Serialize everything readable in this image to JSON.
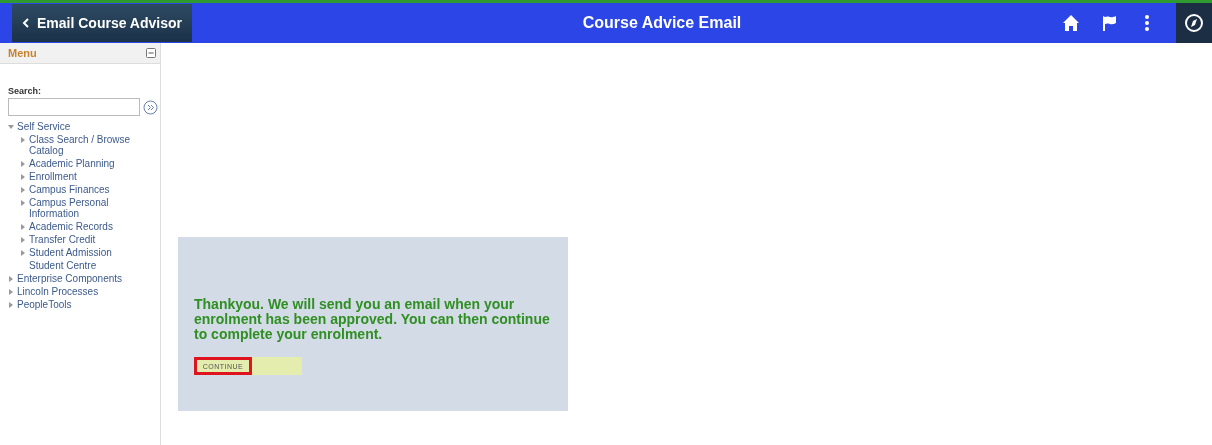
{
  "header": {
    "back_label": "Email Course Advisor",
    "title": "Course Advice Email"
  },
  "menu": {
    "title": "Menu",
    "search_label": "Search:",
    "items": [
      {
        "label": "Self Service",
        "kind": "folder",
        "expanded": true,
        "children": [
          {
            "label": "Class Search / Browse Catalog",
            "kind": "folder",
            "expanded": false
          },
          {
            "label": "Academic Planning",
            "kind": "folder",
            "expanded": false
          },
          {
            "label": "Enrollment",
            "kind": "folder",
            "expanded": false
          },
          {
            "label": "Campus Finances",
            "kind": "folder",
            "expanded": false
          },
          {
            "label": "Campus Personal Information",
            "kind": "folder",
            "expanded": false
          },
          {
            "label": "Academic Records",
            "kind": "folder",
            "expanded": false
          },
          {
            "label": "Transfer Credit",
            "kind": "folder",
            "expanded": false
          },
          {
            "label": "Student Admission",
            "kind": "folder",
            "expanded": false
          },
          {
            "label": "Student Centre",
            "kind": "leaf"
          }
        ]
      },
      {
        "label": "Enterprise Components",
        "kind": "folder",
        "expanded": false
      },
      {
        "label": "Lincoln Processes",
        "kind": "folder",
        "expanded": false
      },
      {
        "label": "PeopleTools",
        "kind": "folder",
        "expanded": false
      }
    ]
  },
  "message": {
    "text": "Thankyou. We will send you an email when your enrolment has been approved. You can then continue to complete your enrolment.",
    "button": "CONTINUE"
  }
}
